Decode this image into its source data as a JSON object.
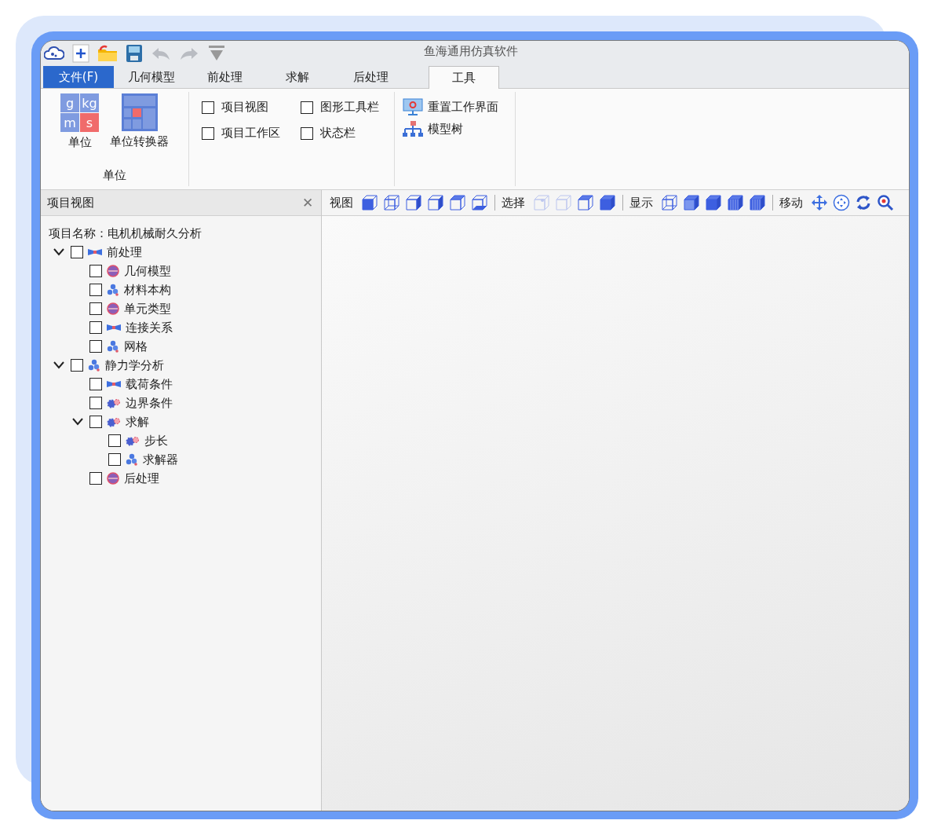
{
  "window": {
    "title": "鱼海通用仿真软件"
  },
  "tabs": [
    {
      "label": "文件(F)",
      "kind": "file",
      "selected": false
    },
    {
      "label": "几何模型",
      "kind": "tab",
      "selected": false
    },
    {
      "label": "前处理",
      "kind": "tab",
      "selected": false
    },
    {
      "label": "求解",
      "kind": "tab",
      "selected": false
    },
    {
      "label": "后处理",
      "kind": "tab",
      "selected": false
    },
    {
      "label": "工具",
      "kind": "tab",
      "selected": true
    }
  ],
  "ribbon": {
    "unit_group": {
      "buttons": [
        {
          "label": "单位",
          "kind": "units"
        },
        {
          "label": "单位转换器",
          "kind": "converter"
        }
      ],
      "caption": "单位",
      "unit_letters": [
        "g",
        "kg",
        "m",
        "s"
      ]
    },
    "checkboxes": [
      {
        "label": "项目视图",
        "checked": false
      },
      {
        "label": "图形工具栏",
        "checked": false
      },
      {
        "label": "项目工作区",
        "checked": false
      },
      {
        "label": "状态栏",
        "checked": false
      }
    ],
    "actions": [
      {
        "label": "重置工作界面",
        "kind": "monitor"
      },
      {
        "label": "模型树",
        "kind": "tree"
      }
    ]
  },
  "project_panel": {
    "title": "项目视图",
    "close": "✕",
    "project_name": "项目名称：电机机械耐久分析",
    "tree": [
      {
        "label": "前处理",
        "kind": "part",
        "checked": false,
        "expanded": true,
        "children": [
          {
            "label": "几何模型",
            "kind": "sphere",
            "checked": false
          },
          {
            "label": "材料本构",
            "kind": "molecule",
            "checked": false
          },
          {
            "label": "单元类型",
            "kind": "sphere",
            "checked": false
          },
          {
            "label": "连接关系",
            "kind": "part",
            "checked": false
          },
          {
            "label": "网格",
            "kind": "molecule",
            "checked": false
          }
        ]
      },
      {
        "label": "静力学分析",
        "kind": "molecule",
        "checked": false,
        "expanded": true,
        "children": [
          {
            "label": "载荷条件",
            "kind": "part",
            "checked": false
          },
          {
            "label": "边界条件",
            "kind": "gears",
            "checked": false
          },
          {
            "label": "求解",
            "kind": "gears",
            "checked": false,
            "expanded": true,
            "children": [
              {
                "label": "步长",
                "kind": "gears",
                "checked": false
              },
              {
                "label": "求解器",
                "kind": "molecule",
                "checked": false
              }
            ]
          },
          {
            "label": "后处理",
            "kind": "sphere",
            "checked": false
          }
        ]
      }
    ]
  },
  "view_toolbar": {
    "groups": [
      {
        "label": "视图",
        "kind": "view"
      },
      {
        "label": "选择",
        "kind": "select"
      },
      {
        "label": "显示",
        "kind": "display"
      },
      {
        "label": "移动",
        "kind": "move"
      }
    ]
  }
}
